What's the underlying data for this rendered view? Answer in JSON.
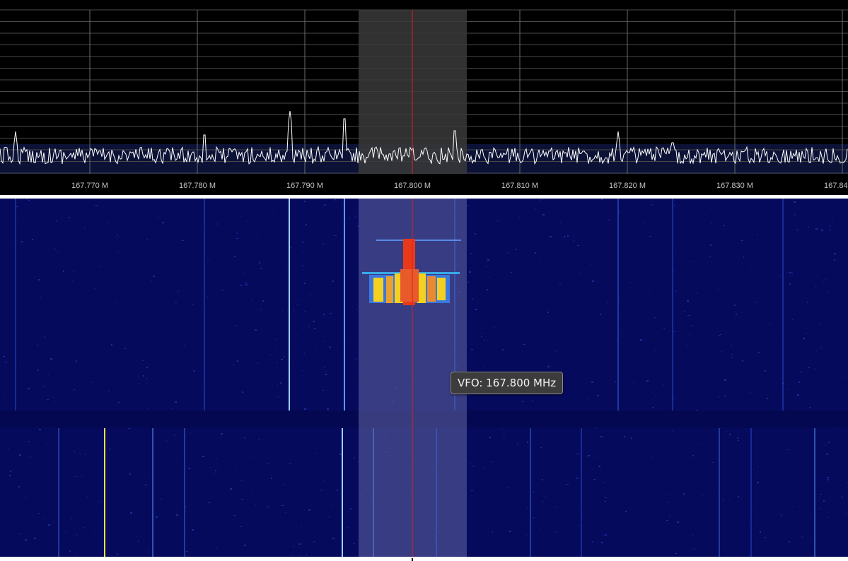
{
  "spectrum": {
    "frequency_labels": [
      "167.770 M",
      "167.780 M",
      "167.790 M",
      "167.800 M",
      "167.810 M",
      "167.820 M",
      "167.830 M",
      "167.84"
    ],
    "colors": {
      "background": "#000000",
      "plot_fill": "#0c1236",
      "grid": "#5a5a5a",
      "trace": "#ffffff",
      "passband": "#3a3a3a",
      "vfo_marker": "#e02020"
    }
  },
  "waterfall": {
    "colors": {
      "background": "#060a5c",
      "passband": "#4a4d8f",
      "signal_hot": "#e83a1a",
      "signal_warm": "#f4d020",
      "signal_cool": "#3aa8e8"
    }
  },
  "tooltip": {
    "vfo_text": "VFO: 167.800 MHz"
  }
}
